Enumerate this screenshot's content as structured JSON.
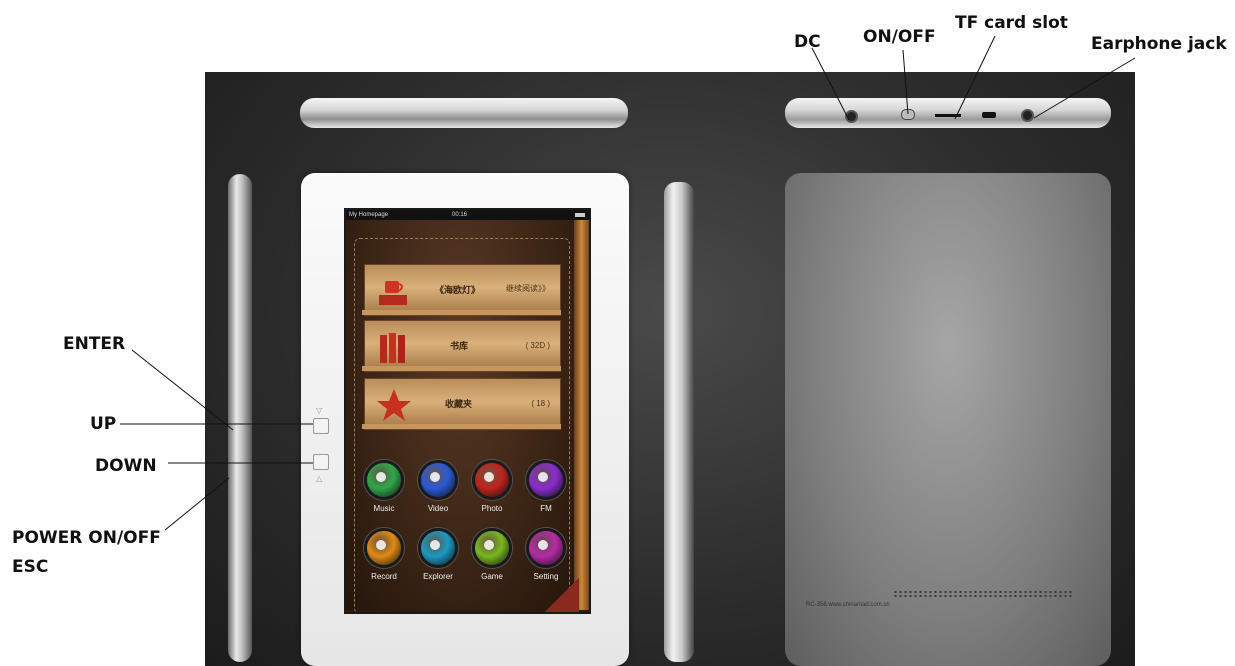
{
  "callouts": {
    "dc": "DC",
    "on_off": "ON/OFF",
    "tf_card_slot": "TF card slot",
    "earphone_jack": "Earphone jack",
    "enter": "ENTER",
    "up": "UP",
    "down": "DOWN",
    "power_on_off": "POWER ON/OFF",
    "esc": "ESC"
  },
  "screen": {
    "status": {
      "home": "My Homepage",
      "time": "00:16"
    },
    "shelves": [
      {
        "title": "《海欧灯》",
        "right": "继续阅读》》",
        "icon": "book-cup-icon"
      },
      {
        "title": "书库",
        "right": "( 32D )",
        "icon": "books-icon"
      },
      {
        "title": "收藏夹",
        "right": "( 18 )",
        "icon": "star-icon"
      }
    ],
    "apps": [
      {
        "label": "Music",
        "color": "#2fa84a",
        "icon": "music-icon"
      },
      {
        "label": "Video",
        "color": "#2a5ad8",
        "icon": "video-icon"
      },
      {
        "label": "Photo",
        "color": "#c0231c",
        "icon": "photo-icon"
      },
      {
        "label": "FM",
        "color": "#8a2bd0",
        "icon": "fm-icon"
      },
      {
        "label": "Record",
        "color": "#e08a14",
        "icon": "record-icon"
      },
      {
        "label": "Explorer",
        "color": "#1a9ac4",
        "icon": "explorer-icon"
      },
      {
        "label": "Game",
        "color": "#7ab81e",
        "icon": "game-icon"
      },
      {
        "label": "Setting",
        "color": "#b72aa8",
        "icon": "setting-icon"
      }
    ]
  },
  "back": {
    "model_text": "RC-356  www.chinamad.com.cn"
  }
}
